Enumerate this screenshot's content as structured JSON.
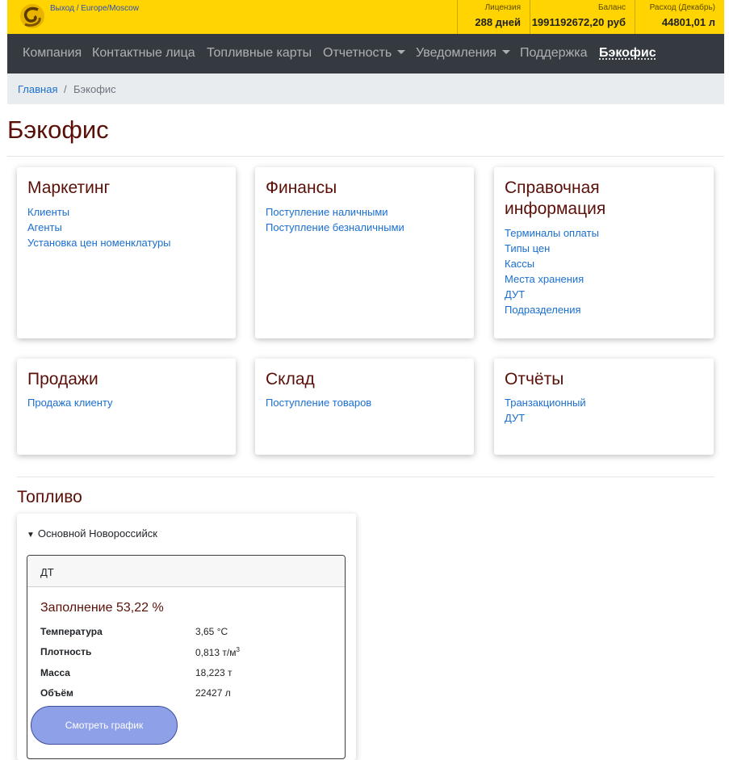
{
  "header": {
    "logout": "Выход",
    "sep": "/",
    "timezone": "Europe/Moscow",
    "stats": [
      {
        "label": "Лицензия",
        "value": "288 дней"
      },
      {
        "label": "Баланс",
        "value": "1991192672,20 руб"
      },
      {
        "label": "Расход (Декабрь)",
        "value": "44801,01 л"
      }
    ]
  },
  "nav": {
    "items": [
      "Компания",
      "Контактные лица",
      "Топливные карты",
      "Отчетность",
      "Уведомления",
      "Поддержка",
      "Бэкофис"
    ]
  },
  "breadcrumb": {
    "home": "Главная",
    "sep": "/",
    "current": "Бэкофис"
  },
  "page_title": "Бэкофис",
  "cards": [
    {
      "title": "Маркетинг",
      "links": [
        "Клиенты",
        "Агенты",
        "Установка цен номенклатуры"
      ]
    },
    {
      "title": "Финансы",
      "links": [
        "Поступление наличными",
        "Поступление безналичными"
      ]
    },
    {
      "title_line1": "Справочная",
      "title_line2": "информация",
      "links": [
        "Терминалы оплаты",
        "Типы цен",
        "Кассы",
        "Места хранения",
        "ДУТ",
        "Подразделения"
      ]
    },
    {
      "title": "Продажи",
      "links": [
        "Продажа клиенту"
      ]
    },
    {
      "title": "Склад",
      "links": [
        "Поступление товаров"
      ]
    },
    {
      "title": "Отчёты",
      "links": [
        "Транзакционный",
        "ДУТ"
      ]
    }
  ],
  "fuel": {
    "section_title": "Топливо",
    "summary_marker": "▼",
    "station": "Основной Новороссийск",
    "tank": {
      "name": "ДТ",
      "fill": "Заполнение 53,22 %",
      "params": [
        {
          "label": "Температура",
          "value": "3,65 °C"
        },
        {
          "label": "Плотность",
          "value": "0,813 т/м",
          "sup": "3"
        },
        {
          "label": "Масса",
          "value": "18,223 т"
        },
        {
          "label": "Объём",
          "value": "22427 л"
        }
      ],
      "button": "Смотреть график"
    }
  }
}
